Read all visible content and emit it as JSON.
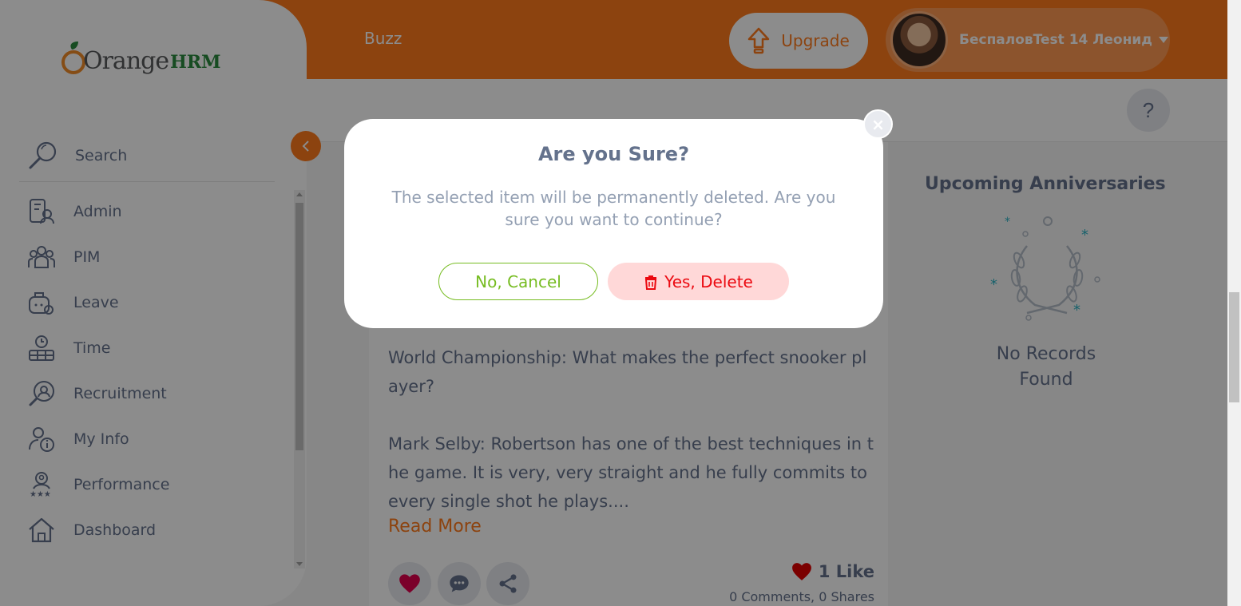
{
  "header": {
    "title": "Buzz",
    "upgrade_label": "Upgrade",
    "user_name": "БеспаловTest 14 Леонид",
    "help_label": "?"
  },
  "sidebar": {
    "logo_a": "Orange",
    "logo_b": "HRM",
    "search_placeholder": "Search",
    "items": [
      {
        "label": "Admin",
        "icon": "admin-icon"
      },
      {
        "label": "PIM",
        "icon": "pim-icon"
      },
      {
        "label": "Leave",
        "icon": "leave-icon"
      },
      {
        "label": "Time",
        "icon": "time-icon"
      },
      {
        "label": "Recruitment",
        "icon": "recruitment-icon"
      },
      {
        "label": "My Info",
        "icon": "my-info-icon"
      },
      {
        "label": "Performance",
        "icon": "performance-icon"
      },
      {
        "label": "Dashboard",
        "icon": "dashboard-icon"
      }
    ]
  },
  "post": {
    "paragraph1": "World Championship: What makes the perfect snooker player?",
    "paragraph2": "Mark Selby: Robertson has one of the best techniques in the game. It is very, very straight and he fully commits to every single shot he plays....",
    "read_more": "Read More",
    "likes": "1 Like",
    "comments_shares": "0 Comments, 0 Shares"
  },
  "anniversaries": {
    "title": "Upcoming Anniversaries",
    "empty": "No Records Found"
  },
  "dialog": {
    "title": "Are you Sure?",
    "message": "The selected item will be permanently deleted. Are you sure you want to continue?",
    "cancel_label": "No, Cancel",
    "delete_label": "Yes, Delete",
    "close_label": "×"
  },
  "colors": {
    "brand": "#ff7b1d",
    "text": "#64728c",
    "cancel": "#76bc21",
    "delete": "#eb0910"
  }
}
